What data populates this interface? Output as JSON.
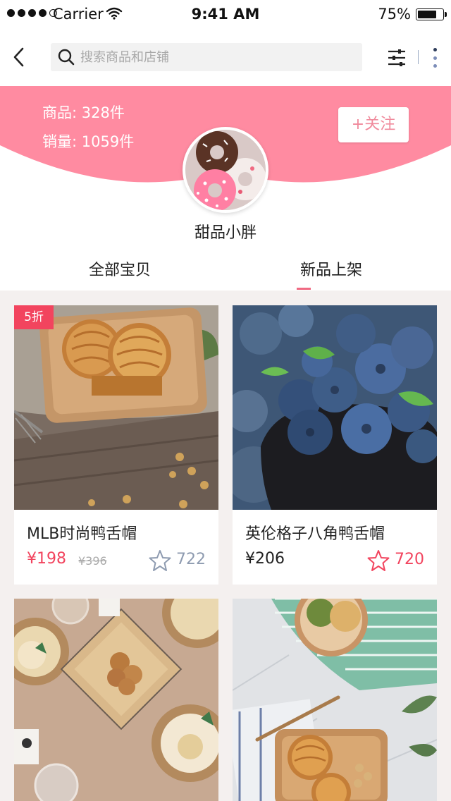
{
  "status_bar": {
    "carrier": "Carrier",
    "time": "9:41 AM",
    "battery": "75%"
  },
  "nav": {
    "search_placeholder": "搜索商品和店铺",
    "icons": [
      "back-arrow-icon",
      "search-icon",
      "filter-icon",
      "more-icon"
    ]
  },
  "shop": {
    "goods_label": "商品: 328件",
    "sales_label": "销量: 1059件",
    "follow_label": "+关注",
    "name": "甜品小胖",
    "avatar": "donuts-avatar"
  },
  "tabs": [
    {
      "label": "全部宝贝",
      "active": false
    },
    {
      "label": "新品上架",
      "active": true
    }
  ],
  "products": [
    {
      "title": "MLB时尚鸭舌帽",
      "price": "¥198",
      "original_price": "¥396",
      "badge": "5折",
      "likes": "722",
      "favorited": false,
      "image": "mooncakes-on-wooden-plate"
    },
    {
      "title": "英伦格子八角鸭舌帽",
      "price": "¥206",
      "likes": "720",
      "favorited": true,
      "image": "blueberries-in-bowl"
    },
    {
      "image": "bread-basket-table"
    },
    {
      "image": "mooncake-and-beans-marble"
    }
  ],
  "colors": {
    "brand_pink": "#ff8ba1",
    "accent_red": "#f2445e",
    "follow_text": "#f08a9c"
  }
}
